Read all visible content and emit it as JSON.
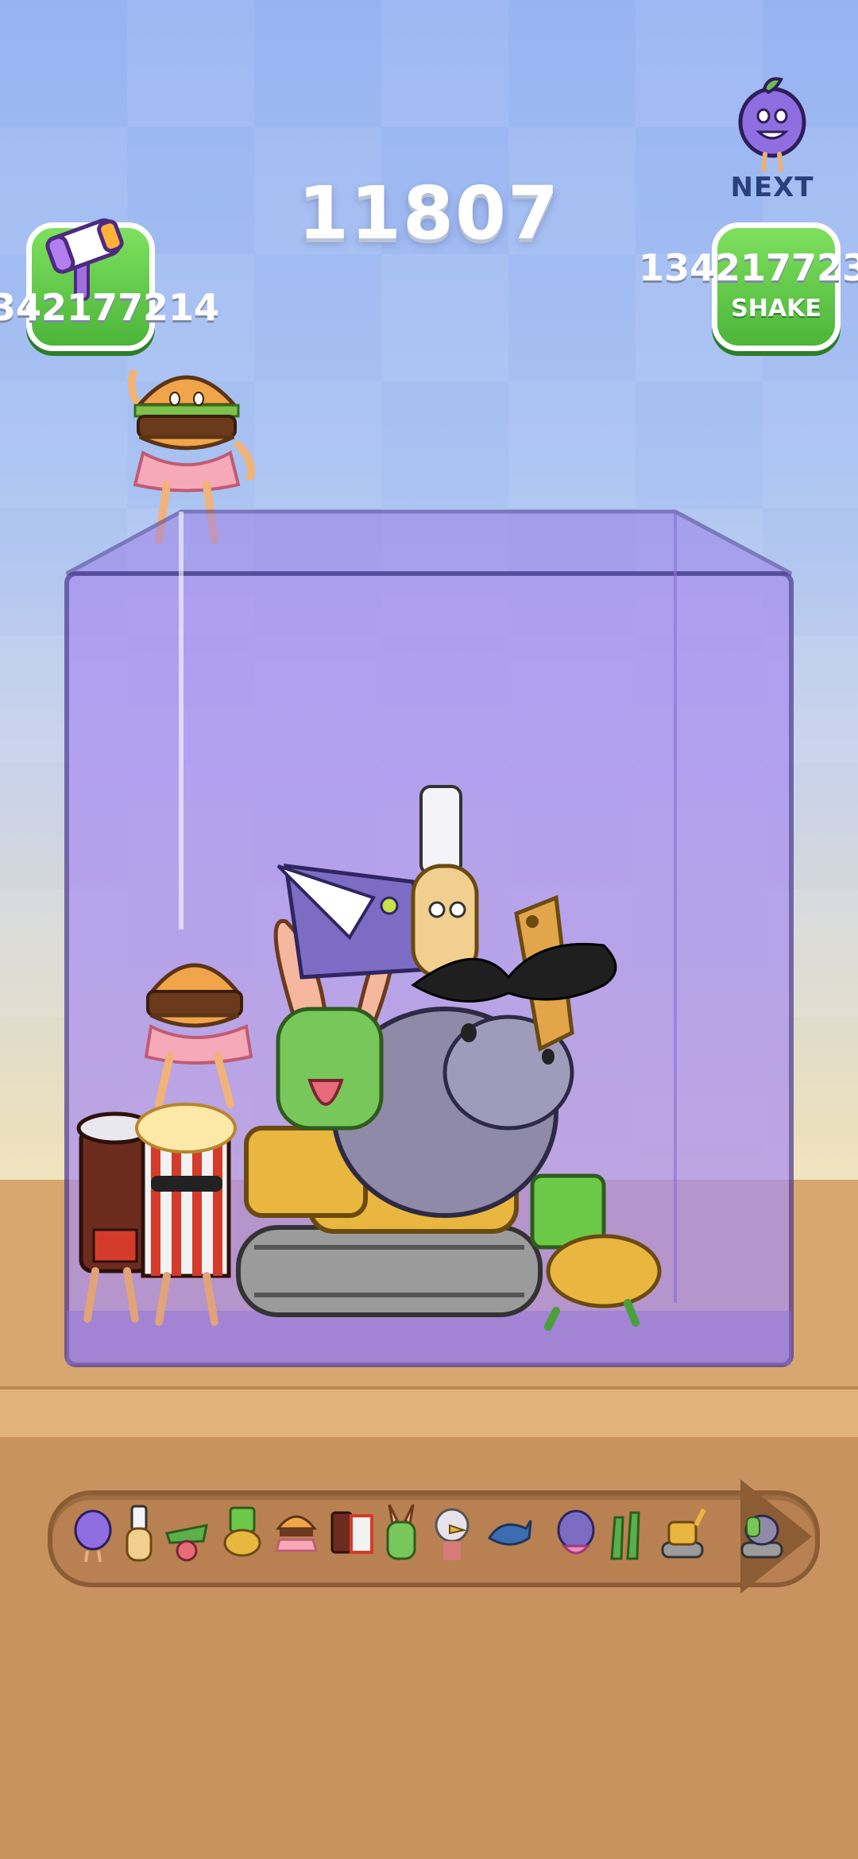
{
  "game": {
    "score": "11807",
    "next_label": "NEXT",
    "hammer_count": "342177214",
    "shake_count": "134217723",
    "shake_label": "SHAKE"
  },
  "icons": {
    "hammer": "hammer-icon",
    "next_item": "grape-character-icon",
    "held": "burger-character-icon"
  },
  "colors": {
    "button_green": "#4cb53a",
    "box_purple": "#a98ef0",
    "score_white": "#ffffff",
    "next_text": "#28417e"
  },
  "evolution_chain": [
    "grape",
    "toothbrush",
    "crocodile",
    "green-cube-burger",
    "burger",
    "soda-popcorn",
    "cactus-bunny",
    "eagle",
    "whale",
    "hippo",
    "giraffe",
    "excavator",
    "excavator-hippo"
  ]
}
